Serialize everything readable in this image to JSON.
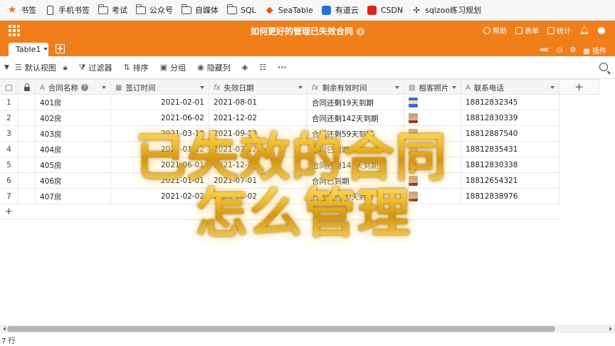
{
  "bookmarks": {
    "items": [
      {
        "label": "书签",
        "icon": "star-icon"
      },
      {
        "label": "手机书签",
        "icon": "phone-icon"
      },
      {
        "label": "考试",
        "icon": "folder-icon"
      },
      {
        "label": "公众号",
        "icon": "folder-icon"
      },
      {
        "label": "自媒体",
        "icon": "folder-icon"
      },
      {
        "label": "SQL",
        "icon": "folder-icon"
      },
      {
        "label": "SeaTable",
        "icon": "seatable-icon"
      },
      {
        "label": "有道云",
        "icon": "youdao-icon"
      },
      {
        "label": "CSDN",
        "icon": "csdn-icon"
      },
      {
        "label": "sqlzoo练习规划",
        "icon": "sqlzoo-icon"
      }
    ]
  },
  "app": {
    "title": "如何更好的管理已失效合同",
    "brand_color": "#f07f1b",
    "tools": {
      "help": "帮助",
      "form": "表单",
      "stats": "统计",
      "plugins": "插件"
    },
    "tab": {
      "label": "Table1"
    }
  },
  "toolbar": {
    "view": "默认视图",
    "filter": "过滤器",
    "sort": "排序",
    "group": "分组",
    "hide": "隐藏列"
  },
  "table": {
    "columns": [
      {
        "label": "合同名称",
        "icon": "text-icon"
      },
      {
        "label": "签订时间",
        "icon": "date-icon"
      },
      {
        "label": "失效日期",
        "icon": "formula-icon"
      },
      {
        "label": "剩余有效时间",
        "icon": "formula-icon"
      },
      {
        "label": "租客照片",
        "icon": "image-icon"
      },
      {
        "label": "联系电话",
        "icon": "text-icon"
      }
    ],
    "rows": [
      {
        "num": "1",
        "name": "401房",
        "signed": "2021-02-01",
        "expire": "2021-08-01",
        "remaining": "合同还剩19天到期",
        "phone": "18812832345"
      },
      {
        "num": "2",
        "name": "402房",
        "signed": "2021-06-02",
        "expire": "2021-12-02",
        "remaining": "合同还剩142天到期",
        "phone": "18812830339"
      },
      {
        "num": "3",
        "name": "403房",
        "signed": "2021-03-10",
        "expire": "2021-09-10",
        "remaining": "合同还剩59天到期",
        "phone": "18812887540"
      },
      {
        "num": "4",
        "name": "404房",
        "signed": "2021-01-12",
        "expire": "2021-07-12",
        "remaining": "合同已到期",
        "phone": "18812835431"
      },
      {
        "num": "5",
        "name": "405房",
        "signed": "2021-06-01",
        "expire": "2021-12-01",
        "remaining": "合同还剩141天到期",
        "phone": "18812830338"
      },
      {
        "num": "6",
        "name": "406房",
        "signed": "2021-01-01",
        "expire": "2021-07-01",
        "remaining": "合同已到期",
        "phone": "18812654321"
      },
      {
        "num": "7",
        "name": "407房",
        "signed": "2021-02-02",
        "expire": "2021-08-02",
        "remaining": "合同还剩20天到期",
        "phone": "18812838976"
      }
    ]
  },
  "footer": {
    "count": "7 行"
  },
  "overlay": {
    "line1": "已失效的合同",
    "line2": "怎么管理"
  }
}
